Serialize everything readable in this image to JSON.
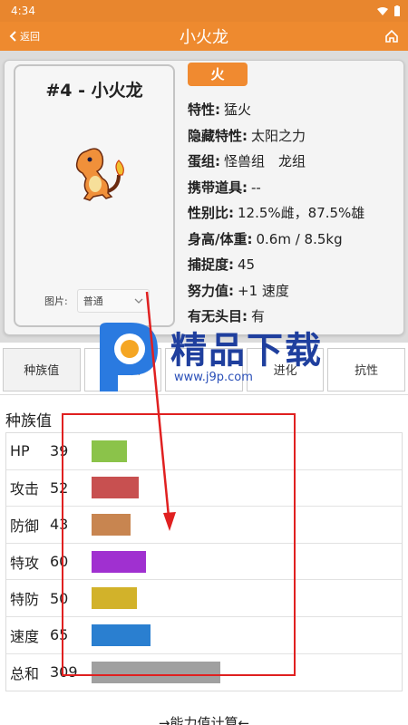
{
  "status": {
    "time": "4:34"
  },
  "app_bar": {
    "back_label": "返回",
    "title": "小火龙"
  },
  "pokemon": {
    "heading": "#4 - 小火龙",
    "type": "火",
    "pic_label": "图片:",
    "pic_value": "普通",
    "info": [
      {
        "key": "特性:",
        "value": "猛火"
      },
      {
        "key": "隐藏特性:",
        "value": "太阳之力"
      },
      {
        "key": "蛋组:",
        "value": "怪兽组　龙组"
      },
      {
        "key": "携带道具:",
        "value": "--"
      },
      {
        "key": "性别比:",
        "value": "12.5%雌，87.5%雄"
      },
      {
        "key": "身高/体重:",
        "value": "0.6m / 8.5kg"
      },
      {
        "key": "捕捉度:",
        "value": "45"
      },
      {
        "key": "努力值:",
        "value": "+1 速度"
      },
      {
        "key": "有无头目:",
        "value": "有"
      }
    ]
  },
  "tabs": [
    "种族值",
    "招式表",
    "",
    "进化",
    "抗性"
  ],
  "stats": {
    "label": "种族值",
    "rows": [
      {
        "name": "HP",
        "value": 39,
        "color": "#8bc34a"
      },
      {
        "name": "攻击",
        "value": 52,
        "color": "#c85050"
      },
      {
        "name": "防御",
        "value": 43,
        "color": "#c88550"
      },
      {
        "name": "特攻",
        "value": 60,
        "color": "#a030d0"
      },
      {
        "name": "特防",
        "value": 50,
        "color": "#d2b22a"
      },
      {
        "name": "速度",
        "value": 65,
        "color": "#2a7fd0"
      },
      {
        "name": "总和",
        "value": 309,
        "color": "#a0a0a0"
      }
    ]
  },
  "calc_label": "能力值计算",
  "watermark": {
    "brand": "精品下载",
    "url": "www.j9p.com"
  }
}
